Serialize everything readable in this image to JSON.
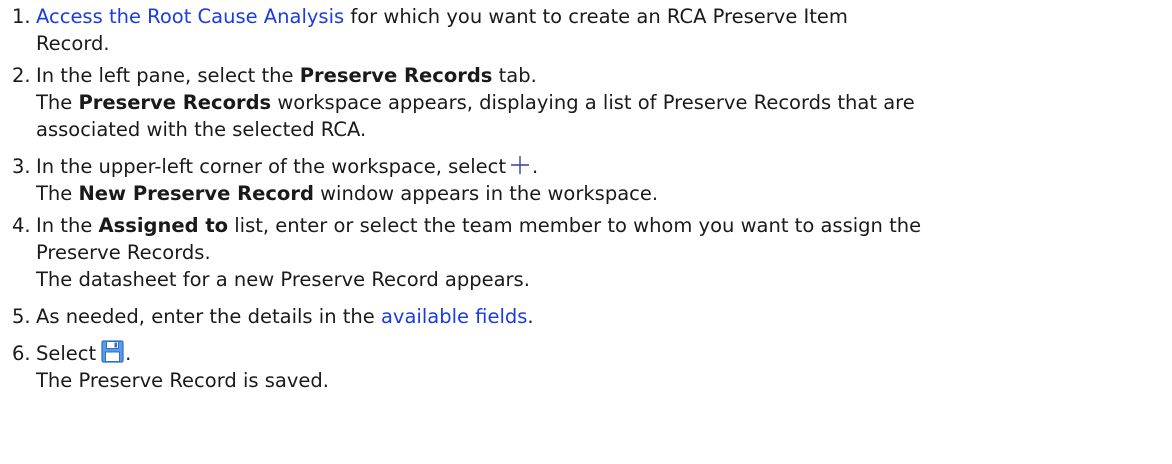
{
  "steps": [
    {
      "num": "1.",
      "link": "Access the Root Cause Analysis",
      "rest": " for which you want to create an RCA Preserve Item",
      "line2": "Record."
    },
    {
      "num": "2.",
      "pre": "In the left pane, select the ",
      "bold": "Preserve Records",
      "post": " tab.",
      "result_bold": "Preserve Records",
      "result_rest": " workspace appears, displaying a list of Preserve Records that are",
      "result_line2": "associated with the selected RCA.",
      "result_the": "The "
    },
    {
      "num": "3.",
      "pre": "In the upper-left corner of the workspace, select",
      "post": ".",
      "icon": "plus-icon",
      "result_the": "The ",
      "result_bold": "New Preserve Record",
      "result_rest": " window appears in the workspace."
    },
    {
      "num": "4.",
      "pre": "In the ",
      "bold": "Assigned to",
      "post": " list, enter or select the team member to whom you want to assign the",
      "line2": "Preserve Records.",
      "result": "The datasheet for a new Preserve Record appears."
    },
    {
      "num": "5.",
      "pre": "As needed, enter the details in the ",
      "link": "available fields",
      "post": "."
    },
    {
      "num": "6.",
      "pre": "Select",
      "post": ".",
      "icon": "save-icon",
      "result": "The Preserve Record is saved."
    }
  ],
  "colors": {
    "link": "#1a3ce0",
    "text": "#1a1a1a",
    "icon_blue": "#3d82d8"
  }
}
